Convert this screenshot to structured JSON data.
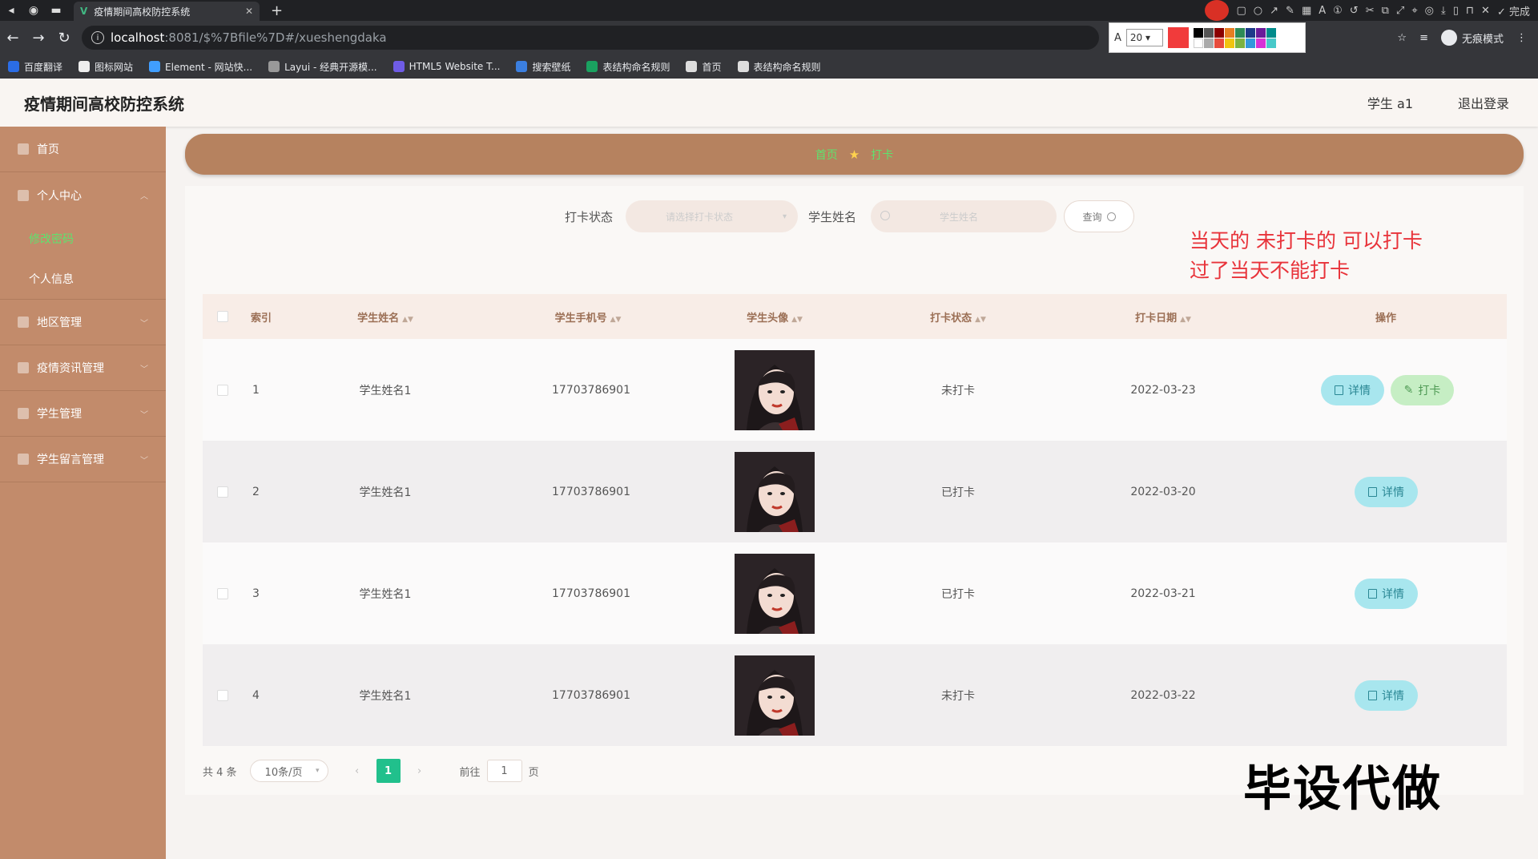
{
  "browser": {
    "tab_title": "疫情期间高校防控系统",
    "url_host": "localhost",
    "url_path": ":8081/$%7Bfile%7D#/xueshengdaka",
    "incognito_label": "无痕模式",
    "done_label": "完成",
    "annot_font_size": "20",
    "bookmarks": [
      {
        "label": "百度翻译",
        "color": "#2b6de6"
      },
      {
        "label": "图标网站",
        "color": "#eeeeee"
      },
      {
        "label": "Element - 网站快...",
        "color": "#409eff"
      },
      {
        "label": "Layui - 经典开源模...",
        "color": "#999999"
      },
      {
        "label": "HTML5 Website T...",
        "color": "#6f5ce6"
      },
      {
        "label": "搜索壁纸",
        "color": "#3b7fe0"
      },
      {
        "label": "表结构命名规则",
        "color": "#1aa260"
      },
      {
        "label": "首页",
        "color": "#dddddd"
      },
      {
        "label": "表结构命名规则",
        "color": "#dddddd"
      }
    ]
  },
  "header": {
    "title": "疫情期间高校防控系统",
    "user": "学生 a1",
    "logout": "退出登录"
  },
  "sidebar": {
    "items": [
      {
        "label": "首页"
      },
      {
        "label": "个人中心"
      },
      {
        "label": "地区管理"
      },
      {
        "label": "疫情资讯管理"
      },
      {
        "label": "学生管理"
      },
      {
        "label": "学生留言管理"
      }
    ],
    "sub": [
      {
        "label": "修改密码"
      },
      {
        "label": "个人信息"
      }
    ]
  },
  "breadcrumb": {
    "home": "首页",
    "current": "打卡"
  },
  "search": {
    "status_label": "打卡状态",
    "status_placeholder": "请选择打卡状态",
    "name_label": "学生姓名",
    "name_placeholder": "学生姓名",
    "query_label": "查询"
  },
  "annotation": {
    "line1": "当天的 未打卡的 可以打卡",
    "line2": "过了当天不能打卡"
  },
  "table": {
    "columns": [
      "索引",
      "学生姓名",
      "学生手机号",
      "学生头像",
      "打卡状态",
      "打卡日期",
      "操作"
    ],
    "rows": [
      {
        "index": "1",
        "name": "学生姓名1",
        "phone": "17703786901",
        "status": "未打卡",
        "date": "2022-03-23",
        "can_clock": true
      },
      {
        "index": "2",
        "name": "学生姓名1",
        "phone": "17703786901",
        "status": "已打卡",
        "date": "2022-03-20",
        "can_clock": false
      },
      {
        "index": "3",
        "name": "学生姓名1",
        "phone": "17703786901",
        "status": "已打卡",
        "date": "2022-03-21",
        "can_clock": false
      },
      {
        "index": "4",
        "name": "学生姓名1",
        "phone": "17703786901",
        "status": "未打卡",
        "date": "2022-03-22",
        "can_clock": false
      }
    ],
    "detail_label": "详情",
    "clock_label": "打卡"
  },
  "pager": {
    "total": "共 4 条",
    "page_size": "10条/页",
    "current": "1",
    "goto_prefix": "前往",
    "goto_value": "1",
    "goto_suffix": "页"
  },
  "watermark": "毕设代做",
  "colors": {
    "sidebar": "#c28b6b",
    "breadcrumb_bar": "#b6825f",
    "active_green": "#5fe26e",
    "pager_active": "#21c08c",
    "annotation_red": "#e8333a"
  }
}
